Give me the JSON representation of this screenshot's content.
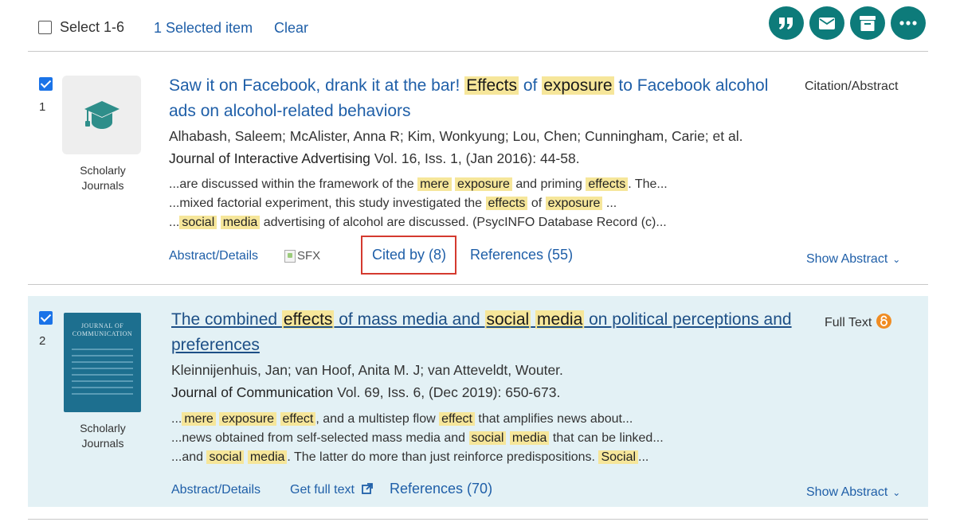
{
  "toolbar": {
    "select_label": "Select 1-6",
    "selected_label": "1 Selected item",
    "clear_label": "Clear",
    "actions": [
      {
        "name": "cite",
        "icon": "quote-icon"
      },
      {
        "name": "email",
        "icon": "envelope-icon"
      },
      {
        "name": "save",
        "icon": "archive-box-icon"
      },
      {
        "name": "more",
        "icon": "ellipsis-icon"
      }
    ],
    "accent_color": "#0d7b7a"
  },
  "results": [
    {
      "number": "1",
      "checked": true,
      "thumbnail_icon": "graduation-cap-icon",
      "source_type": "Scholarly Journals",
      "title": {
        "segments": [
          "Saw it on Facebook, drank it at the bar! ",
          "Effects",
          " of ",
          "exposure",
          " to Facebook alcohol ads on alcohol-related behaviors"
        ]
      },
      "authors": "Alhabash, Saleem; McAlister, Anna R; Kim, Wonkyung; Lou, Chen; Cunningham, Carie; et al.",
      "journal_name": "Journal of Interactive Advertising",
      "journal_details": " Vol. 16, Iss. 1,  (Jan 2016): 44-58.",
      "snippets": [
        [
          "...are discussed within the framework of the ",
          "mere",
          " ",
          "exposure",
          " and priming ",
          "effects",
          ". The..."
        ],
        [
          "...mixed factorial experiment, this study investigated the ",
          "effects",
          " of ",
          "exposure",
          " ..."
        ],
        [
          "...",
          "social",
          " ",
          "media",
          " advertising of alcohol are discussed. (PsycINFO Database Record (c)..."
        ]
      ],
      "doc_type": "Citation/Abstract",
      "links": {
        "abstract": "Abstract/Details",
        "sfx": "SFX",
        "cited_by": "Cited by (8)",
        "references": "References (55)",
        "show_abstract": "Show Abstract"
      }
    },
    {
      "number": "2",
      "checked": true,
      "cover_title": "JOURNAL OF COMMUNICATION",
      "source_type": "Scholarly Journals",
      "title": {
        "segments": [
          "The combined ",
          "effects",
          " of mass media and ",
          "social",
          " ",
          "media",
          " on political perceptions and preferences"
        ]
      },
      "authors": "Kleinnijenhuis, Jan; van Hoof, Anita M. J; van Atteveldt, Wouter.",
      "journal_name": "Journal of Communication",
      "journal_details": " Vol. 69, Iss. 6,  (Dec 2019): 650-673.",
      "snippets": [
        [
          "...",
          "mere",
          " ",
          "exposure",
          " ",
          "effect",
          ", and a multistep flow ",
          "effect",
          " that amplifies news about..."
        ],
        [
          "...news obtained from self-selected mass media and ",
          "social",
          " ",
          "media",
          " that can be linked..."
        ],
        [
          "...and ",
          "social",
          " ",
          "media",
          ". The latter do more than just reinforce predispositions. ",
          "Social",
          "..."
        ]
      ],
      "doc_type": "Full Text",
      "open_access_icon": "open-access-icon",
      "links": {
        "abstract": "Abstract/Details",
        "full_text": "Get full text",
        "references": "References (70)",
        "show_abstract": "Show Abstract"
      }
    }
  ],
  "highlight_color": "#f6e69a",
  "link_color": "#1f5fa8"
}
